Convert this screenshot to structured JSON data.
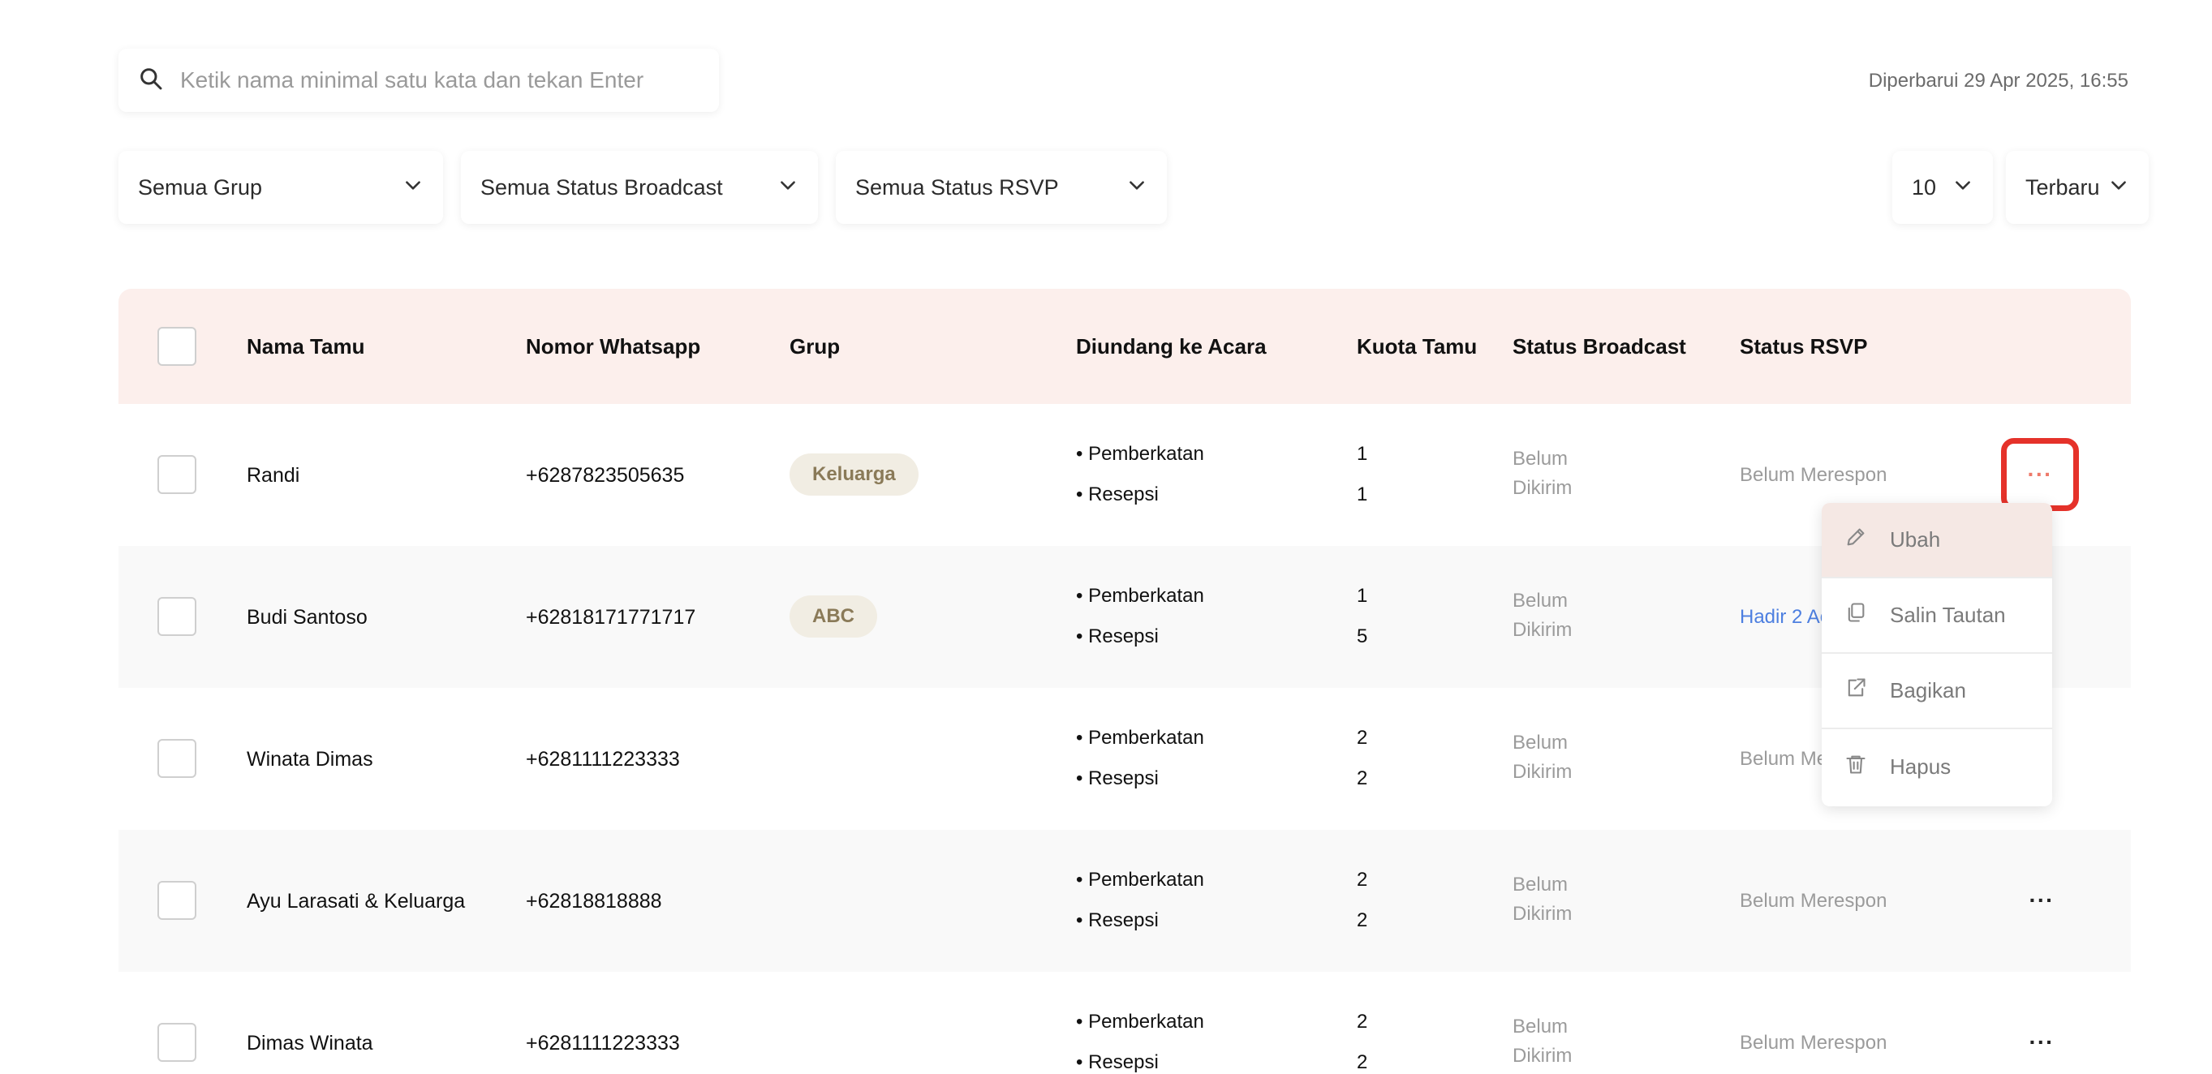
{
  "search": {
    "placeholder": "Ketik nama minimal satu kata dan tekan Enter",
    "icon": "search-icon"
  },
  "updated_text": "Diperbarui 29 Apr 2025, 16:55",
  "filters": {
    "group": "Semua Grup",
    "broadcast": "Semua Status Broadcast",
    "rsvp": "Semua Status RSVP",
    "page_size": "10",
    "sort": "Terbaru"
  },
  "table": {
    "headers": {
      "name": "Nama Tamu",
      "phone": "Nomor Whatsapp",
      "group": "Grup",
      "events": "Diundang ke Acara",
      "quota": "Kuota Tamu",
      "broadcast": "Status Broadcast",
      "rsvp": "Status RSVP"
    },
    "rows": [
      {
        "name": "Randi",
        "phone": "+6287823505635",
        "group": "Keluarga",
        "event1": "• Pemberkatan",
        "event2": "• Resepsi",
        "quota1": "1",
        "quota2": "1",
        "broadcast1": "Belum",
        "broadcast2": "Dikirim",
        "rsvp": "Belum Merespon"
      },
      {
        "name": "Budi Santoso",
        "phone": "+62818171771717",
        "group": "ABC",
        "event1": "• Pemberkatan",
        "event2": "• Resepsi",
        "quota1": "1",
        "quota2": "5",
        "broadcast1": "Belum",
        "broadcast2": "Dikirim",
        "rsvp": "Hadir 2 Ac"
      },
      {
        "name": "Winata Dimas",
        "phone": "+6281111223333",
        "group": "",
        "event1": "• Pemberkatan",
        "event2": "• Resepsi",
        "quota1": "2",
        "quota2": "2",
        "broadcast1": "Belum",
        "broadcast2": "Dikirim",
        "rsvp": "Belum Me"
      },
      {
        "name": "Ayu Larasati & Keluarga",
        "phone": "+62818818888",
        "group": "",
        "event1": "• Pemberkatan",
        "event2": "• Resepsi",
        "quota1": "2",
        "quota2": "2",
        "broadcast1": "Belum",
        "broadcast2": "Dikirim",
        "rsvp": "Belum Merespon"
      },
      {
        "name": "Dimas Winata",
        "phone": "+6281111223333",
        "group": "",
        "event1": "• Pemberkatan",
        "event2": "• Resepsi",
        "quota1": "2",
        "quota2": "2",
        "broadcast1": "Belum",
        "broadcast2": "Dikirim",
        "rsvp": "Belum Merespon"
      }
    ]
  },
  "more_label": "···",
  "menu": {
    "edit": "Ubah",
    "copy_link": "Salin Tautan",
    "share": "Bagikan",
    "delete": "Hapus"
  },
  "colors": {
    "accent": "#e5322a",
    "header_bg": "#fcefec",
    "link_blue": "#4d7fe0"
  }
}
